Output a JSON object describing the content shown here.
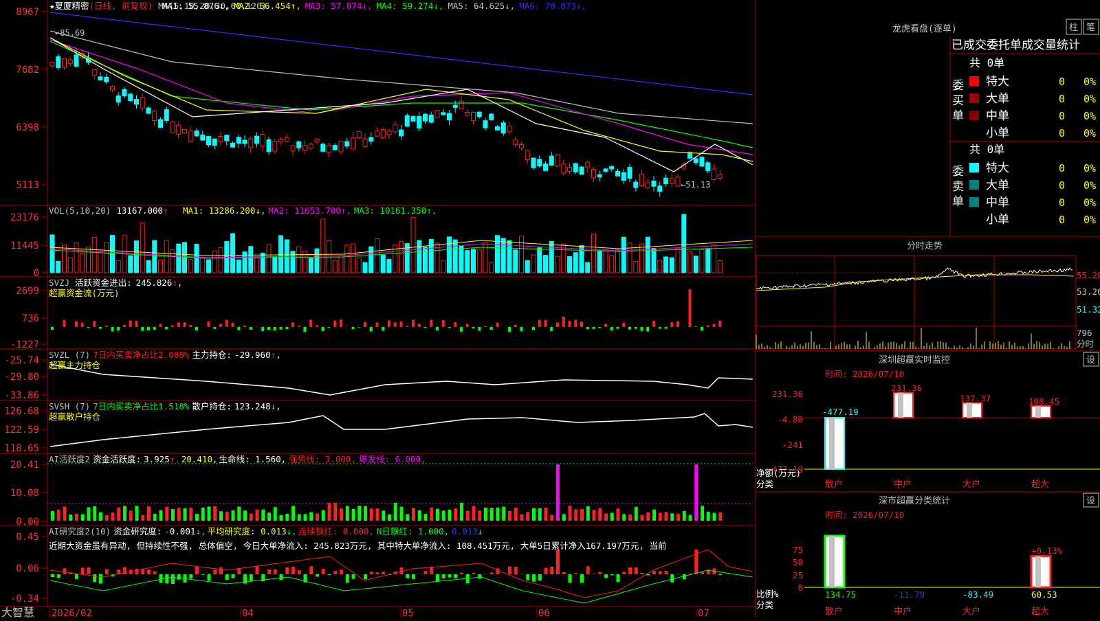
{
  "stock": {
    "name_prefix": "★夏厦精密",
    "period": "(日线, 前复权)"
  },
  "candle_panel": {
    "ma_label": "MA(5,10,20,30,60,120)",
    "mas": [
      {
        "name": "MA1",
        "value": "55.876",
        "arrow": "↓",
        "color": "#ffffff"
      },
      {
        "name": "MA2",
        "value": "56.454",
        "arrow": "↑",
        "color": "#ffff00"
      },
      {
        "name": "MA3",
        "value": "57.874",
        "arrow": "↓",
        "color": "#ff00ff"
      },
      {
        "name": "MA4",
        "value": "59.274",
        "arrow": "↓",
        "color": "#00ff00"
      },
      {
        "name": "MA5",
        "value": "64.625",
        "arrow": "↓",
        "color": "#c0c0c0"
      },
      {
        "name": "MA6",
        "value": "70.873",
        "arrow": "↓",
        "color": "#3030ff"
      }
    ],
    "y_ticks": [
      "8967",
      "7682",
      "6398",
      "5113"
    ],
    "high_marker": "←85.69",
    "low_marker": "←51.13"
  },
  "vol_panel": {
    "label": "VOL(5,10,20)",
    "value": "13167.000",
    "value_arrow": "↑",
    "mas": [
      {
        "name": "MA1",
        "value": "13286.200",
        "arrow": "↓",
        "color": "#ffff00"
      },
      {
        "name": "MA2",
        "value": "11653.700",
        "arrow": "↑",
        "color": "#ff00ff"
      },
      {
        "name": "MA3",
        "value": "10161.350",
        "arrow": "↑",
        "color": "#00ff00"
      }
    ],
    "y_ticks": [
      "23176",
      "11445",
      "0"
    ]
  },
  "svzj_panel": {
    "label": "SVZJ",
    "desc": "活跃资金进出:",
    "value": "245.826",
    "arrow": "↑",
    "sub": "超赢资金流(万元)",
    "y_ticks": [
      "2699",
      "736",
      "-1227"
    ]
  },
  "svzl_panel": {
    "label": "SVZL (7)",
    "ratio": "7日内买卖净占比2.008%",
    "desc": "主力持仓:",
    "value": "-29.960",
    "arrow": "↑",
    "sub": "超赢主力持仓",
    "y_ticks": [
      "-25.74",
      "-29.80",
      "-33.86"
    ]
  },
  "svsh_panel": {
    "label": "SVSH (7)",
    "ratio": "7日内买卖净占比1.518%",
    "desc": "散户持仓:",
    "value": "123.248",
    "arrow": "↓",
    "sub": "超赢散户持仓",
    "y_ticks": [
      "126.68",
      "122.59",
      "118.65"
    ]
  },
  "ai_active_panel": {
    "label": "AI活跃度2",
    "desc": "资金活跃度:",
    "value": "3.925",
    "v2": "20.410",
    "life_line": "生命线: 1.560,",
    "strong_line": "强势线: 3.000,",
    "burst_line": "爆发线: 6.000,",
    "y_ticks": [
      "20.41",
      "10.08",
      "0.00"
    ]
  },
  "ai_research_panel": {
    "label": "AI研究度2(10)",
    "desc": "资金研究度:",
    "value": "-0.001",
    "avg": "平均研究度: 0.013",
    "streak": "连续飘红: 0.000,",
    "n_red": "N日飘红: 1.000,",
    "last": "0.013",
    "comment": "近期大资金虽有异动, 但持续性不强, 总体偏空, 今日大单净流入: 245.823万元, 其中特大单净流入: 108.451万元, 大单5日累计净入167.197万元, 当前",
    "y_ticks": [
      "0.45",
      "0.06",
      "-0.34"
    ]
  },
  "x_axis": {
    "brand": "大智慧",
    "labels": [
      "2026/02",
      "04",
      "05",
      "06",
      "07"
    ]
  },
  "dragon_tiger": {
    "title": "龙虎看盘(逐单)",
    "btn_zhu": "柱",
    "btn_bi": "笔",
    "header": "已成交委托单成交量统计",
    "buy_label": "委买单",
    "sell_label": "委卖单",
    "buy_total": "共 0单",
    "sell_total": "共 0单",
    "buy_rows": [
      {
        "name": "特大",
        "count": "0",
        "pct": "0%",
        "color": "#ff0000"
      },
      {
        "name": "大单",
        "count": "0",
        "pct": "0%",
        "color": "#a00000"
      },
      {
        "name": "中单",
        "count": "0",
        "pct": "0%",
        "color": "#800000"
      },
      {
        "name": "小单",
        "count": "0",
        "pct": "0%",
        "color": "#000000"
      }
    ],
    "sell_rows": [
      {
        "name": "特大",
        "count": "0",
        "pct": "0%",
        "color": "#00ffff"
      },
      {
        "name": "大单",
        "count": "0",
        "pct": "0%",
        "color": "#008080"
      },
      {
        "name": "中单",
        "count": "0",
        "pct": "0%",
        "color": "#008080"
      },
      {
        "name": "小单",
        "count": "0",
        "pct": "0%",
        "color": "#000000"
      }
    ]
  },
  "intraday": {
    "title": "分时走势",
    "price_ticks": [
      "55.20",
      "53.26",
      "51.32"
    ],
    "vol_tick": "796",
    "vol_unit": "分时"
  },
  "sz_monitor": {
    "title": "深圳超赢实时监控",
    "btn": "设",
    "time": "时间: 2026/07/10",
    "y_ticks": [
      "231.36",
      "-4.80",
      "-241",
      "-477.19"
    ],
    "bars": [
      {
        "cat": "散户",
        "value": -477.19,
        "label": "-477.19"
      },
      {
        "cat": "中户",
        "value": 231.36,
        "label": "231.36"
      },
      {
        "cat": "大户",
        "value": 137.37,
        "label": "137.37"
      },
      {
        "cat": "超大",
        "value": 108.45,
        "label": "108.45"
      }
    ],
    "ylabel": "净额(万元)",
    "xlabel": "分类"
  },
  "sz_classify": {
    "title": "深市超赢分类统计",
    "btn": "设",
    "time": "时间: 2026/07/10",
    "y_ticks": [
      "75",
      "50",
      "25",
      "0"
    ],
    "top_label": "+0.13%",
    "bars": [
      {
        "cat": "散户",
        "value": 134.75,
        "label": "134.75",
        "color": "#00ff00"
      },
      {
        "cat": "中户",
        "value": -11.79,
        "label": "-11.79",
        "color": "#3030ff"
      },
      {
        "cat": "大户",
        "value": -83.49,
        "label": "-83.49",
        "color": "#00ffff"
      },
      {
        "cat": "超大",
        "value": 60.53,
        "label": "60.53",
        "color": "#ffff00"
      }
    ],
    "ylabel": "比例%",
    "xlabel": "分类"
  }
}
